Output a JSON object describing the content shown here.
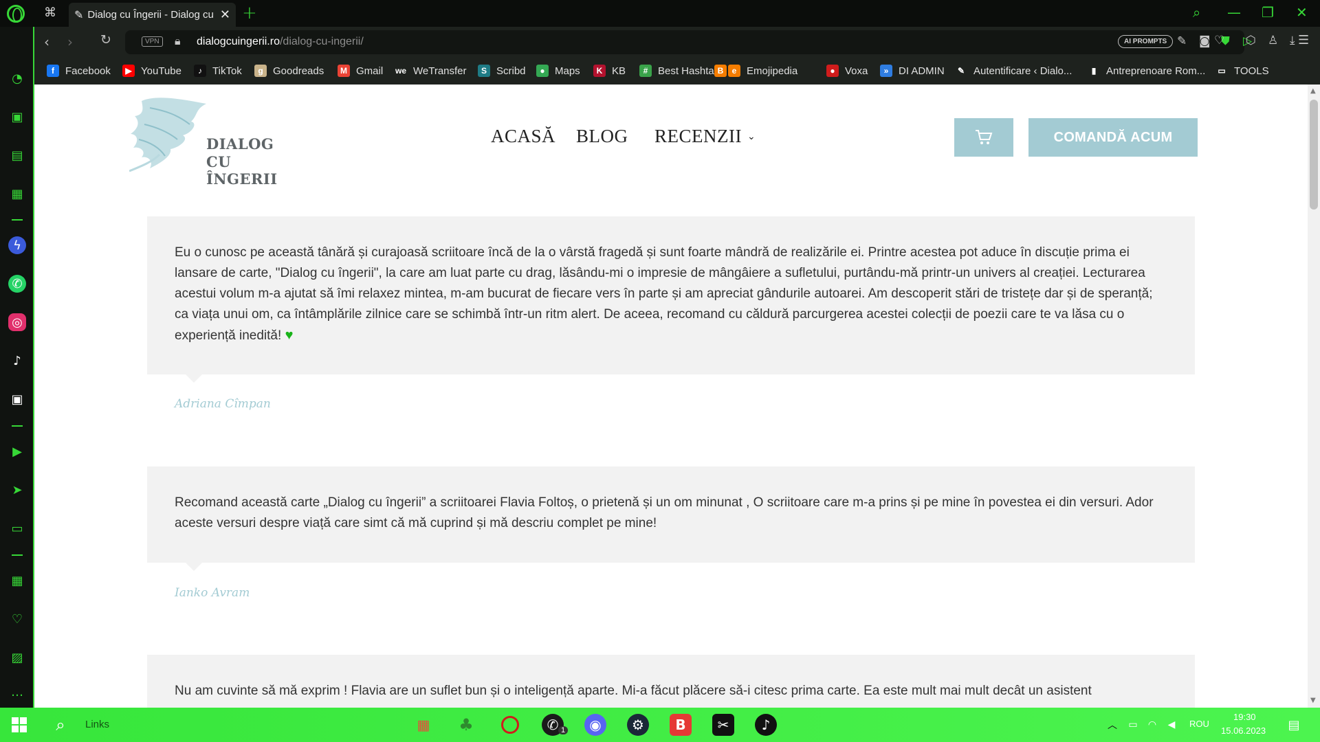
{
  "browser": {
    "tab_title": "Dialog cu Îngerii - Dialog cu",
    "url_host": "dialogcuingerii.ro",
    "url_path": "/dialog-cu-ingerii/",
    "vpn_label": "VPN",
    "ai_prompts_label": "AI PROMPTS",
    "accent_color": "#37d837"
  },
  "bookmarks": [
    {
      "label": "Facebook",
      "icon": "facebook-icon",
      "color": "#1877f2",
      "glyph": "f"
    },
    {
      "label": "YouTube",
      "icon": "youtube-icon",
      "color": "#ff0000",
      "glyph": "▶"
    },
    {
      "label": "TikTok",
      "icon": "tiktok-icon",
      "color": "#111111",
      "glyph": "♪"
    },
    {
      "label": "Goodreads",
      "icon": "goodreads-icon",
      "color": "#c9b38a",
      "glyph": "g"
    },
    {
      "label": "Gmail",
      "icon": "gmail-icon",
      "color": "#ea4335",
      "glyph": "M"
    },
    {
      "label": "WeTransfer",
      "icon": "wetransfer-icon",
      "color": "#1e221e",
      "glyph": "we"
    },
    {
      "label": "Scribd",
      "icon": "scribd-icon",
      "color": "#1e7b85",
      "glyph": "S"
    },
    {
      "label": "Maps",
      "icon": "maps-icon",
      "color": "#34a853",
      "glyph": "●"
    },
    {
      "label": "KB",
      "icon": "kb-icon",
      "color": "#b3122e",
      "glyph": "K"
    },
    {
      "label": "Best Hashtag",
      "icon": "hashtag-icon",
      "color": "#3aa34a",
      "glyph": "#"
    },
    {
      "label": "",
      "icon": "blogger-icon",
      "color": "#f57d00",
      "glyph": "B"
    },
    {
      "label": "Emojipedia",
      "icon": "emojipedia-icon",
      "color": "#f57d00",
      "glyph": "e"
    },
    {
      "label": "Voxa",
      "icon": "voxa-icon",
      "color": "#d01c1c",
      "glyph": "●"
    },
    {
      "label": "DI ADMIN",
      "icon": "di-admin-icon",
      "color": "#2f7de1",
      "glyph": "»"
    },
    {
      "label": "Autentificare ‹ Dialo...",
      "icon": "angel-icon",
      "color": "#1e221e",
      "glyph": "✎"
    },
    {
      "label": "Antreprenoare Rom...",
      "icon": "document-icon",
      "color": "#1e221e",
      "glyph": "▮"
    },
    {
      "label": "TOOLS",
      "icon": "folder-icon",
      "color": "#1e221e",
      "glyph": "▭"
    }
  ],
  "site": {
    "logo_line1": "DIALOG",
    "logo_line2": "CU ÎNGERII",
    "menu": {
      "home": "ACASĂ",
      "blog": "BLOG",
      "reviews": "RECENZII"
    },
    "order_label": "COMANDĂ ACUM",
    "accent_color": "#a3cbd3"
  },
  "reviews": [
    {
      "text": "Eu o cunosc pe această tânără și curajoasă scriitoare încă de la o vârstă fragedă și sunt foarte mândră de realizările ei. Printre acestea pot aduce în discuție prima ei lansare de carte, \"Dialog cu îngerii\", la care am luat parte cu drag, lăsându-mi o impresie de mângâiere a sufletului, purtându-mă printr-un univers al creației. Lecturarea acestui volum m-a ajutat să îmi relaxez mintea, m-am bucurat de fiecare vers în parte și am apreciat gândurile autoarei. Am descoperit stări de tristețe dar și de speranță; ca viața unui om, ca întâmplările zilnice care se schimbă într-un ritm alert. De aceea, recomand cu căldură parcurgerea acestei colecții de poezii care te va lăsa cu o experiență inedită!",
      "author": "Adriana Cîmpan"
    },
    {
      "text": "Recomand această carte „Dialog cu îngerii” a scriitoarei Flavia Foltoș, o prietenă și un om minunat , O scriitoare care m-a prins și pe mine în povestea ei din versuri. Ador aceste versuri despre viață care simt că mă cuprind și mă descriu complet pe mine!",
      "author": "Ianko Avram"
    },
    {
      "text": "Nu am cuvinte să mă exprim ! Flavia are un suflet bun și o inteligență aparte. Mi-a făcut plăcere să-i citesc prima carte. Ea este mult mai mult decât un asistent",
      "author": ""
    }
  ],
  "taskbar": {
    "search_label": "Links",
    "language": "ROU",
    "time": "19:30",
    "date": "15.06.2023",
    "whatsapp_badge": "1"
  }
}
